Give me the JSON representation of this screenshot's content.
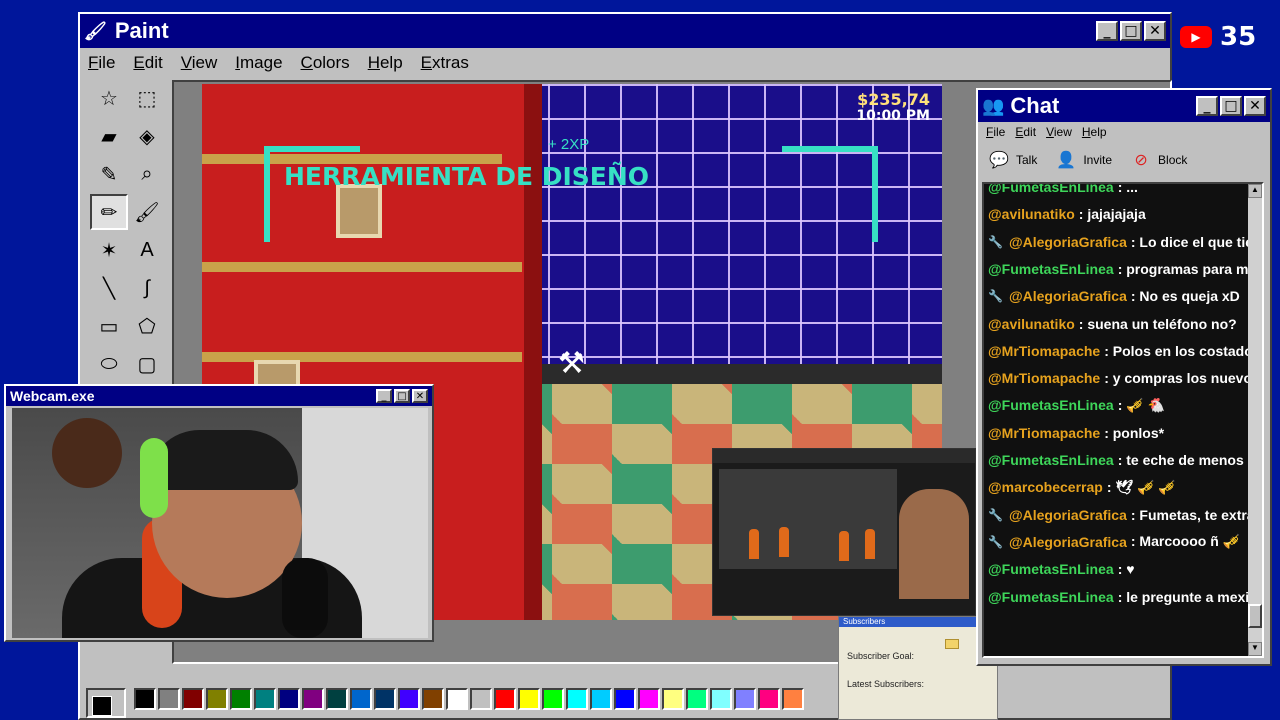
{
  "paint": {
    "title": "Paint",
    "menu": [
      "File",
      "Edit",
      "View",
      "Image",
      "Colors",
      "Help",
      "Extras"
    ],
    "window_controls": [
      "_",
      "□",
      "✕"
    ],
    "palette": [
      "#000000",
      "#808080",
      "#800000",
      "#808000",
      "#008000",
      "#008080",
      "#000080",
      "#800080",
      "#004040",
      "#0066cc",
      "#003366",
      "#4000ff",
      "#804000",
      "#ffffff",
      "#c0c0c0",
      "#ff0000",
      "#ffff00",
      "#00ff00",
      "#00ffff",
      "#00ccff",
      "#0000ff",
      "#ff00ff",
      "#ffff80",
      "#00ff80",
      "#80ffff",
      "#8080ff",
      "#ff0080",
      "#ff8040"
    ]
  },
  "game": {
    "money": "$235,74",
    "time": "10:00 PM",
    "xp": "+ 2XP",
    "title": "HERRAMIENTA DE DISEÑO"
  },
  "webcam": {
    "title": "Webcam.exe",
    "window_controls": [
      "_",
      "□",
      "✕"
    ]
  },
  "subscribers": {
    "header": "Subscribers",
    "goal_label": "Subscriber Goal:",
    "latest_label": "Latest Subscribers:"
  },
  "chat": {
    "title": "Chat",
    "menu": [
      "File",
      "Edit",
      "View",
      "Help"
    ],
    "actions": [
      {
        "label": "Talk",
        "icon": "talk-icon"
      },
      {
        "label": "Invite",
        "icon": "invite-icon"
      },
      {
        "label": "Block",
        "icon": "block-icon"
      }
    ],
    "window_controls": [
      "_",
      "□",
      "✕"
    ],
    "messages": [
      {
        "user": "@FumetasEnLinea",
        "text": ": ...",
        "color": "#3ed65a",
        "wrench": false
      },
      {
        "user": "@avilunatiko",
        "text": ": jajajajaja",
        "color": "#e6a21e",
        "wrench": false
      },
      {
        "user": "@AlegoriaGrafica",
        "text": ": Lo dice el que tiene un",
        "color": "#e6a21e",
        "wrench": true
      },
      {
        "user": "@FumetasEnLinea",
        "text": ": programas para maruja",
        "color": "#3ed65a",
        "wrench": false
      },
      {
        "user": "@AlegoriaGrafica",
        "text": ": No es queja xD",
        "color": "#e6a21e",
        "wrench": true
      },
      {
        "user": "@avilunatiko",
        "text": ": suena un teléfono no?",
        "color": "#e6a21e",
        "wrench": false
      },
      {
        "user": "@MrTiomapache",
        "text": ": Polos en los costados",
        "color": "#e6a21e",
        "wrench": false
      },
      {
        "user": "@MrTiomapache",
        "text": ": y compras los nuevos",
        "color": "#e6a21e",
        "wrench": false
      },
      {
        "user": "@FumetasEnLinea",
        "text": ": 🎺 🐔",
        "color": "#3ed65a",
        "wrench": false
      },
      {
        "user": "@MrTiomapache",
        "text": ": ponlos*",
        "color": "#e6a21e",
        "wrench": false
      },
      {
        "user": "@FumetasEnLinea",
        "text": ": te eche de menos 😢",
        "color": "#3ed65a",
        "wrench": false
      },
      {
        "user": "@marcobecerrap",
        "text": ": 🕊 🎺 🎺",
        "color": "#e6a21e",
        "wrench": false
      },
      {
        "user": "@AlegoriaGrafica",
        "text": ": Fumetas, te extraño <\\",
        "color": "#e6a21e",
        "wrench": true
      },
      {
        "user": "@AlegoriaGrafica",
        "text": ": Marcoooo ñ 🎺",
        "color": "#e6a21e",
        "wrench": true
      },
      {
        "user": "@FumetasEnLinea",
        "text": ": ♥",
        "color": "#3ed65a",
        "wrench": false
      },
      {
        "user": "@FumetasEnLinea",
        "text": ": le pregunte a mexi que",
        "color": "#3ed65a",
        "wrench": false
      }
    ]
  },
  "youtube": {
    "count": "35"
  }
}
